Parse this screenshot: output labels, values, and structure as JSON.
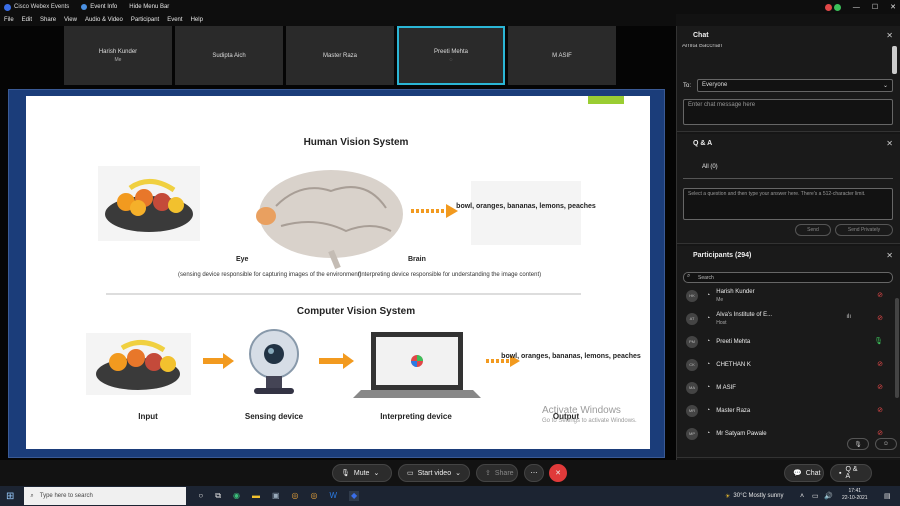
{
  "titlebar": {
    "app_name": "Cisco Webex Events",
    "event_info": "Event Info",
    "hide_menu": "Hide Menu Bar"
  },
  "menu": [
    "File",
    "Edit",
    "Share",
    "View",
    "Audio & Video",
    "Participant",
    "Event",
    "Help"
  ],
  "participant_tiles": [
    {
      "name": "Harish Kunder",
      "sub": "Me"
    },
    {
      "name": "Sudipta Aich",
      "sub": ""
    },
    {
      "name": "Master Raza",
      "sub": ""
    },
    {
      "name": "Preeti Mehta",
      "sub": ""
    },
    {
      "name": "M ASIF",
      "sub": ""
    }
  ],
  "slide": {
    "title_top": "Human Vision System",
    "fruit_label_top": "bowl, oranges, bananas, lemons, peaches",
    "eye_label": "Eye",
    "eye_desc": "(sensing device responsible for capturing images of the environment)",
    "brain_label": "Brain",
    "brain_desc": "(interpreting device responsible for understanding the image content)",
    "title_bottom": "Computer Vision System",
    "fruit_label_bottom": "bowl, oranges, bananas, lemons, peaches",
    "input_label": "Input",
    "sensing_label": "Sensing device",
    "interpreting_label": "Interpreting device",
    "output_label": "Output"
  },
  "watermark": {
    "line1": "Activate Windows",
    "line2": "Go to Settings to activate Windows."
  },
  "controls": {
    "mute": "Mute",
    "start_video": "Start video",
    "share": "Share",
    "chat": "Chat",
    "qa": "Q & A"
  },
  "chat": {
    "title": "Chat",
    "clipped_name": "Amita Bacchan",
    "to_label": "To:",
    "to_value": "Everyone",
    "placeholder": "Enter chat message here"
  },
  "qa": {
    "title": "Q & A",
    "tab_all": "All (0)",
    "hint": "Select a question and then type your answer here. There's a 512-character limit.",
    "send": "Send",
    "send_privately": "Send Privately"
  },
  "participants": {
    "title": "Participants (294)",
    "search_placeholder": "Search",
    "list": [
      {
        "initials": "HK",
        "name": "Harish Kunder",
        "sub": "Me",
        "mic": "muted"
      },
      {
        "initials": "AT",
        "name": "Alva's Institute of E...",
        "sub": "Host",
        "mic": "muted"
      },
      {
        "initials": "PM",
        "name": "Preeti Mehta",
        "sub": "",
        "mic": "active"
      },
      {
        "initials": "CK",
        "name": "CHETHAN K",
        "sub": "",
        "mic": "muted"
      },
      {
        "initials": "MA",
        "name": "M ASIF",
        "sub": "",
        "mic": "muted"
      },
      {
        "initials": "MR",
        "name": "Master Raza",
        "sub": "",
        "mic": "muted"
      },
      {
        "initials": "MP",
        "name": "Mr Satyam Pawale",
        "sub": "",
        "mic": "muted"
      }
    ]
  },
  "taskbar": {
    "search_placeholder": "Type here to search",
    "weather": "30°C Mostly sunny",
    "time": "17:41",
    "date": "22-10-2021"
  },
  "colors": {
    "accent": "#2bb6d6",
    "leave": "#e03a3a",
    "muted": "#e04848",
    "active": "#3cc05a"
  }
}
